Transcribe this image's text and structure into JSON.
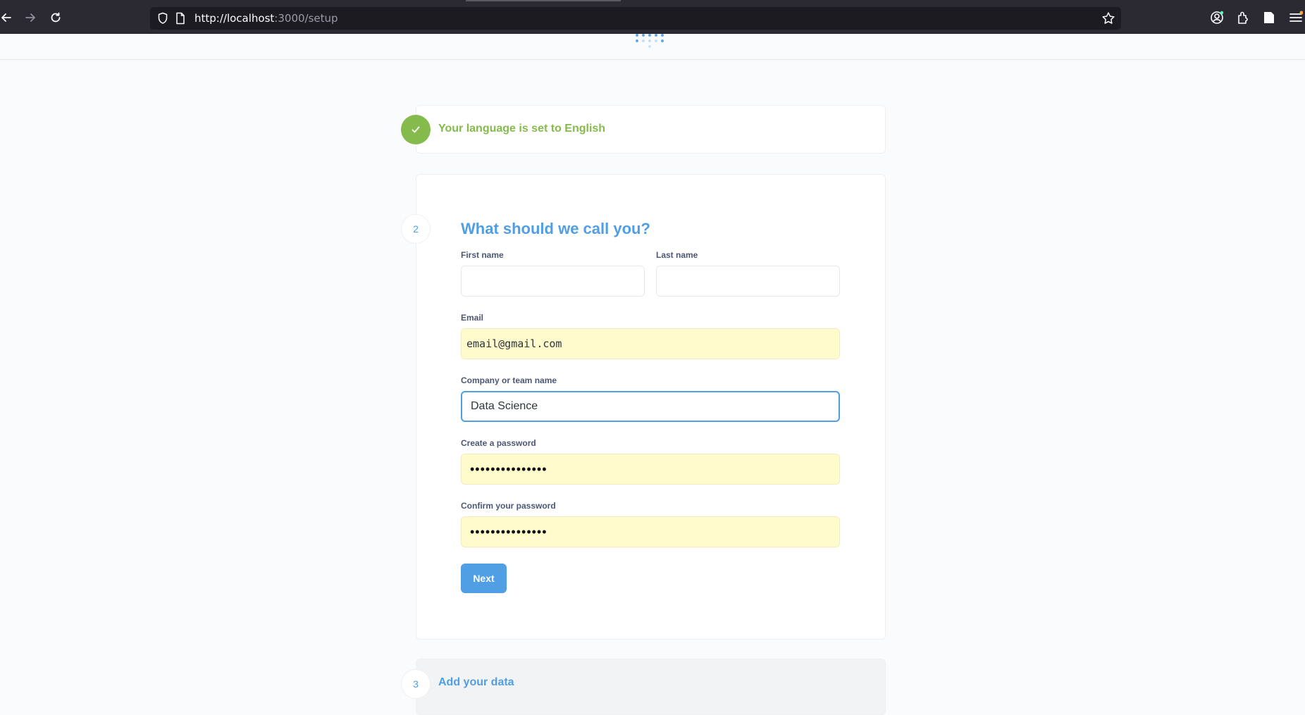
{
  "browser": {
    "url_host": "http://localhost",
    "url_path": ":3000/setup"
  },
  "steps": {
    "language": {
      "text": "Your language is set to English"
    },
    "user": {
      "number": "2",
      "heading": "What should we call you?",
      "first_name": {
        "label": "First name",
        "value": ""
      },
      "last_name": {
        "label": "Last name",
        "value": ""
      },
      "email": {
        "label": "Email",
        "value": "email@gmail.com"
      },
      "company": {
        "label": "Company or team name",
        "value": "Data Science"
      },
      "password": {
        "label": "Create a password",
        "value": "•••••••••••••••"
      },
      "confirm_password": {
        "label": "Confirm your password",
        "value": "•••••••••••••••"
      },
      "next_label": "Next"
    },
    "data": {
      "number": "3",
      "text": "Add your data"
    }
  },
  "colors": {
    "accent": "#509ee3",
    "success": "#84bb4c",
    "autofill": "#fffbcd"
  }
}
